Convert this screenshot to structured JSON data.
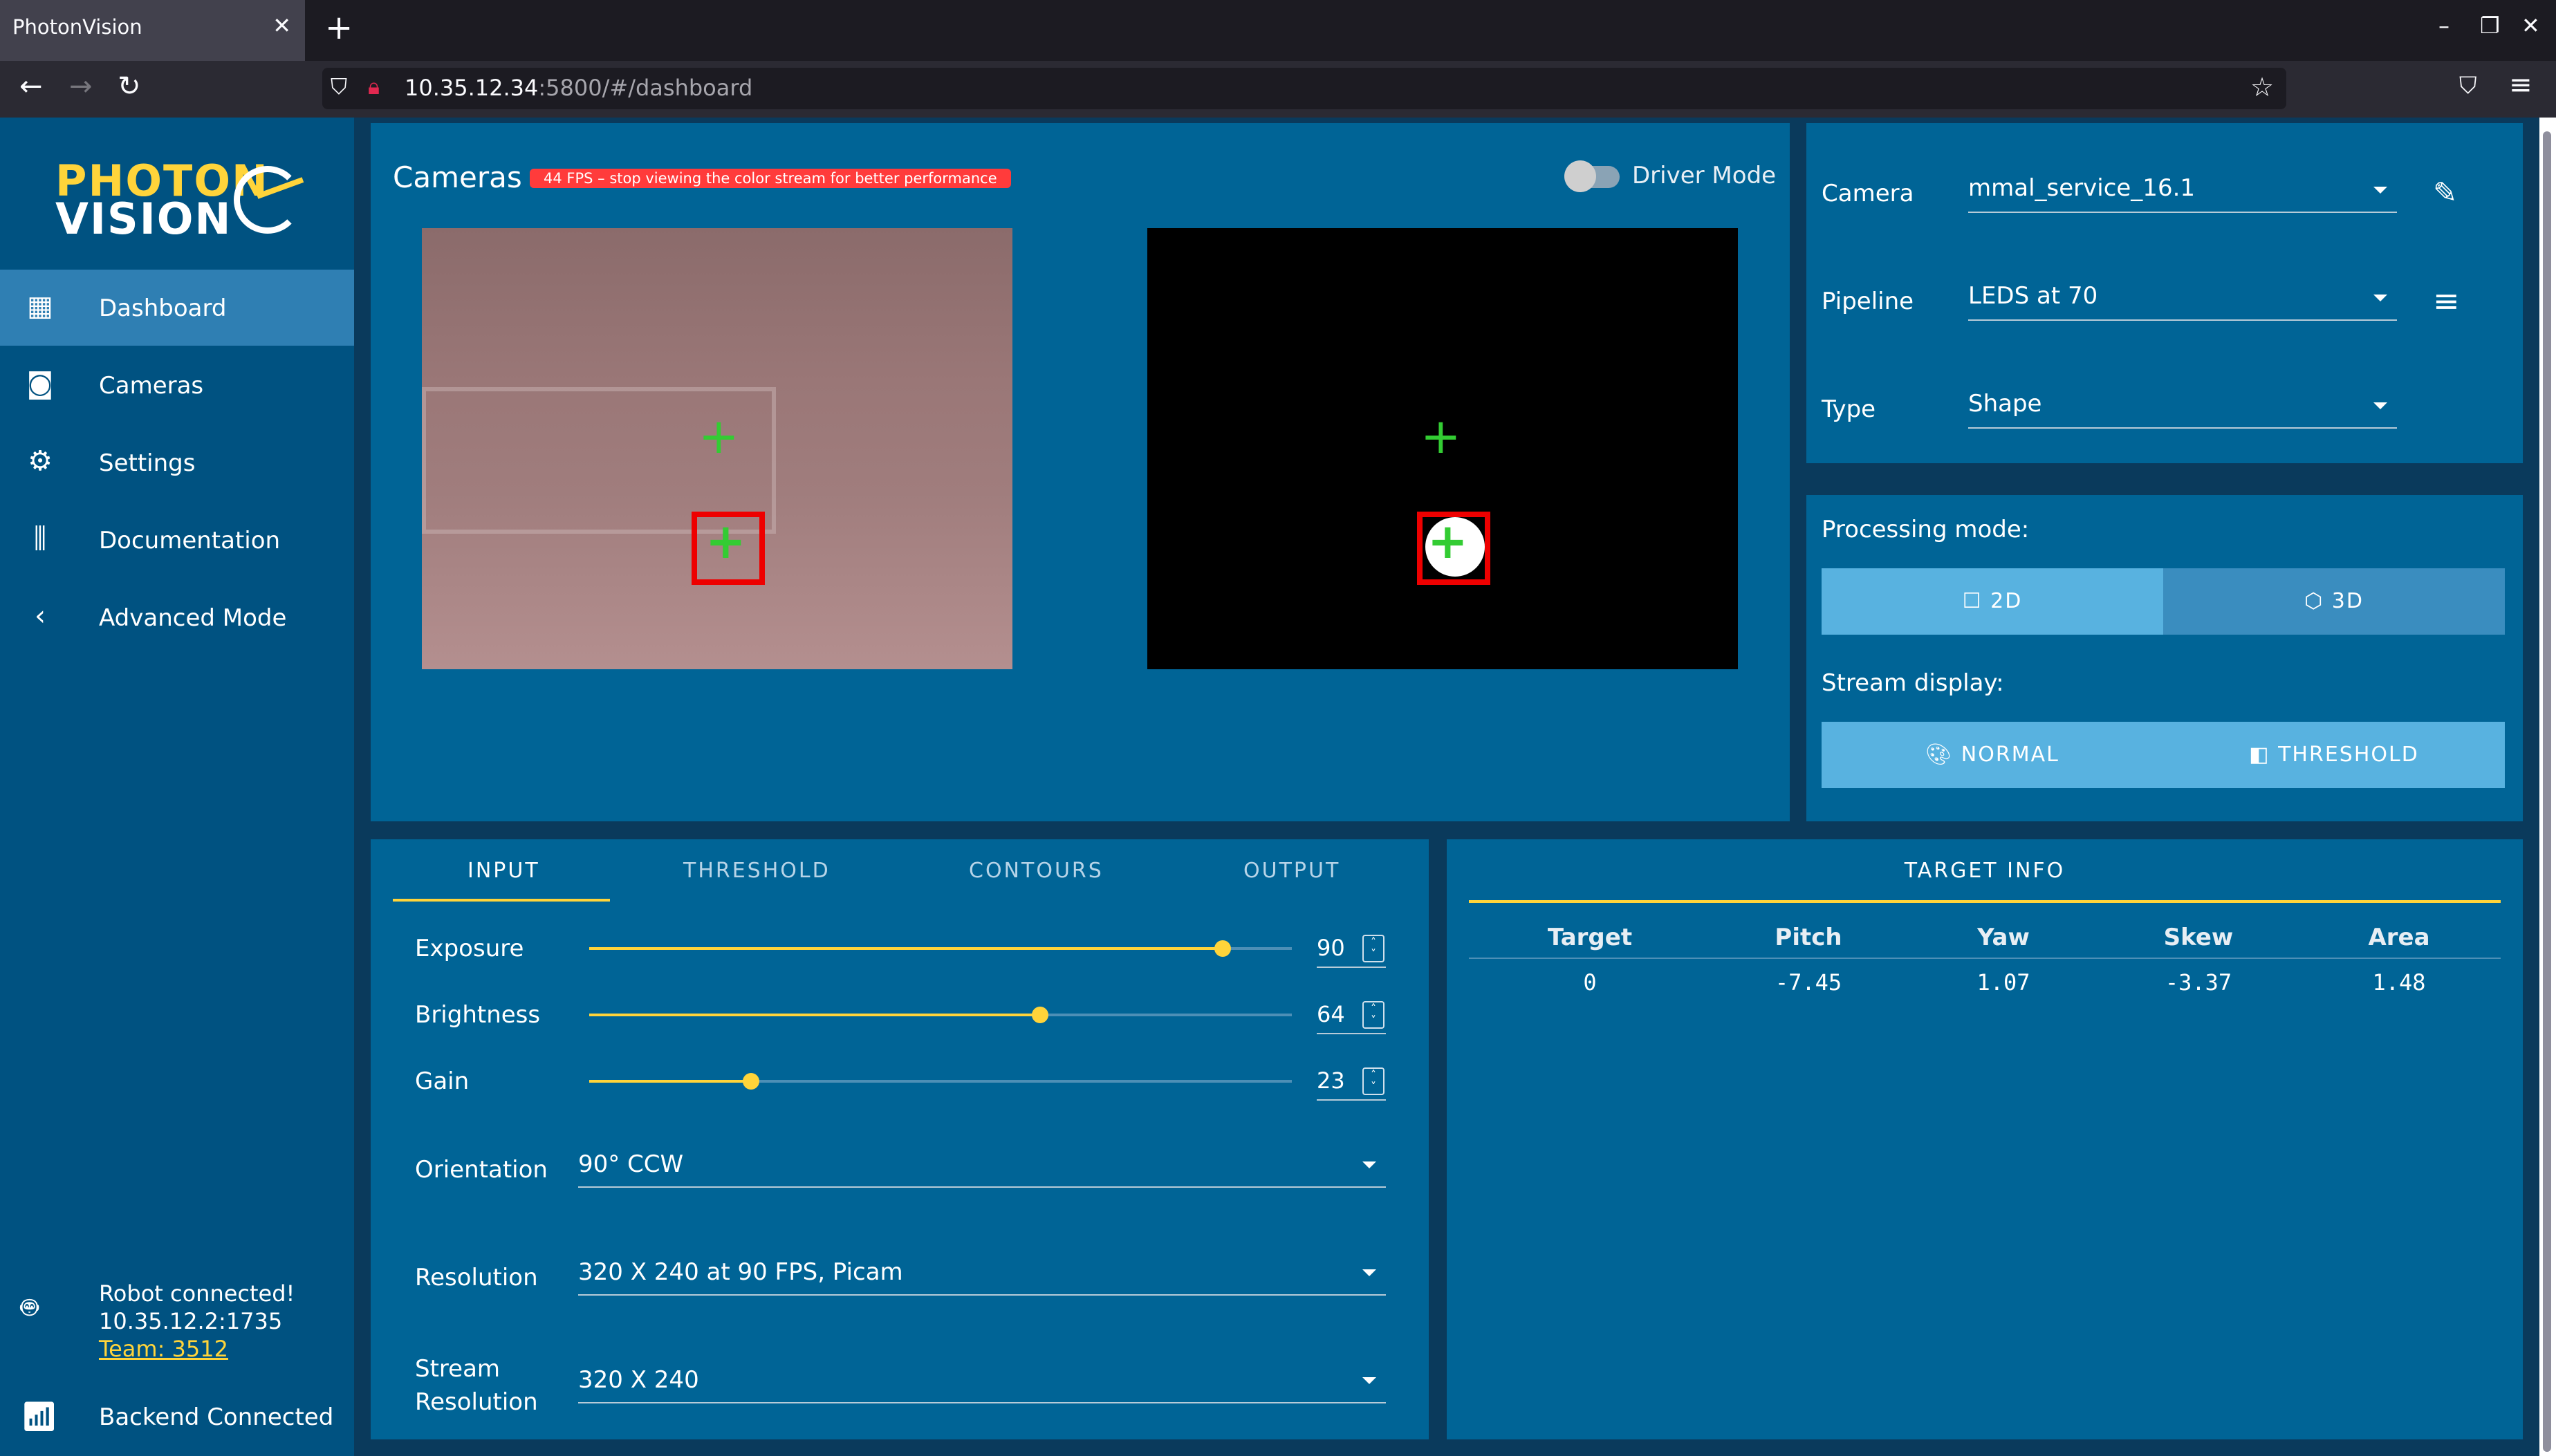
{
  "browser": {
    "tab_title": "PhotonVision",
    "url_host": "10.35.12.34",
    "url_rest": ":5800/#/dashboard"
  },
  "sidebar": {
    "logo_top": "PHOTON",
    "logo_bottom": "VISION",
    "items": [
      {
        "label": "Dashboard",
        "icon": "dashboard-icon"
      },
      {
        "label": "Cameras",
        "icon": "camera-icon"
      },
      {
        "label": "Settings",
        "icon": "gear-icon"
      },
      {
        "label": "Documentation",
        "icon": "library-icon"
      },
      {
        "label": "Advanced Mode",
        "icon": "chevron-left-icon"
      }
    ],
    "robot_status": "Robot connected!",
    "robot_address": "10.35.12.2:1735",
    "team": "Team: 3512",
    "backend_status": "Backend Connected"
  },
  "cameras": {
    "title": "Cameras",
    "fps_badge": "44 FPS – stop viewing the color stream for better performance",
    "driver_mode_label": "Driver Mode"
  },
  "config": {
    "camera_label": "Camera",
    "camera_value": "mmal_service_16.1",
    "pipeline_label": "Pipeline",
    "pipeline_value": "LEDS at 70",
    "type_label": "Type",
    "type_value": "Shape"
  },
  "processing": {
    "mode_label": "Processing mode:",
    "mode_2d": "2D",
    "mode_3d": "3D",
    "stream_label": "Stream display:",
    "stream_normal": "NORMAL",
    "stream_threshold": "THRESHOLD"
  },
  "tabs": {
    "labels": [
      "INPUT",
      "THRESHOLD",
      "CONTOURS",
      "OUTPUT"
    ]
  },
  "input": {
    "exposure_label": "Exposure",
    "exposure_value": 90,
    "brightness_label": "Brightness",
    "brightness_value": 64,
    "gain_label": "Gain",
    "gain_value": 23,
    "orientation_label": "Orientation",
    "orientation_value": "90° CCW",
    "resolution_label": "Resolution",
    "resolution_value": "320 X 240 at 90 FPS, Picam",
    "stream_res_label_1": "Stream",
    "stream_res_label_2": "Resolution",
    "stream_res_value": "320 X 240"
  },
  "target_info": {
    "title": "TARGET INFO",
    "headers": [
      "Target",
      "Pitch",
      "Yaw",
      "Skew",
      "Area"
    ],
    "rows": [
      [
        "0",
        "-7.45",
        "1.07",
        "-3.37",
        "1.48"
      ]
    ]
  }
}
